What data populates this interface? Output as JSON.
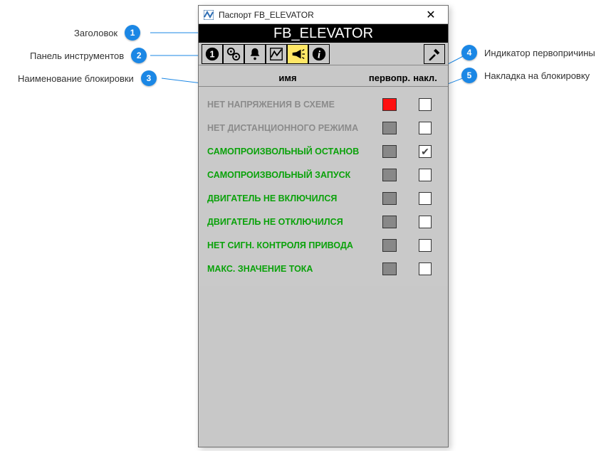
{
  "callouts": {
    "c1": "Заголовок",
    "c2": "Панель инструментов",
    "c3": "Наименование блокировки",
    "c4": "Индикатор первопричины",
    "c5": "Накладка на блокировку"
  },
  "window": {
    "titlebar": "Паспорт FB_ELEVATOR",
    "header": "FB_ELEVATOR"
  },
  "columns": {
    "name": "имя",
    "indicator": "первопр.",
    "overlay": "накл."
  },
  "rows": [
    {
      "name": "НЕТ НАПРЯЖЕНИЯ В СХЕМЕ",
      "style": "grey",
      "indicator": "red",
      "checked": false
    },
    {
      "name": "НЕТ ДИСТАНЦИОННОГО РЕЖИМА",
      "style": "grey",
      "indicator": "grey",
      "checked": false
    },
    {
      "name": "САМОПРОИЗВОЛЬНЫЙ ОСТАНОВ",
      "style": "green",
      "indicator": "grey",
      "checked": true
    },
    {
      "name": "САМОПРОИЗВОЛЬНЫЙ ЗАПУСК",
      "style": "green",
      "indicator": "grey",
      "checked": false
    },
    {
      "name": "ДВИГАТЕЛЬ НЕ ВКЛЮЧИЛСЯ",
      "style": "green",
      "indicator": "grey",
      "checked": false
    },
    {
      "name": "ДВИГАТЕЛЬ НЕ ОТКЛЮЧИЛСЯ",
      "style": "green",
      "indicator": "grey",
      "checked": false
    },
    {
      "name": "НЕТ СИГН. КОНТРОЛЯ ПРИВОДА",
      "style": "green",
      "indicator": "grey",
      "checked": false
    },
    {
      "name": "МАКС. ЗНАЧЕНИЕ ТОКА",
      "style": "green",
      "indicator": "grey",
      "checked": false
    }
  ]
}
